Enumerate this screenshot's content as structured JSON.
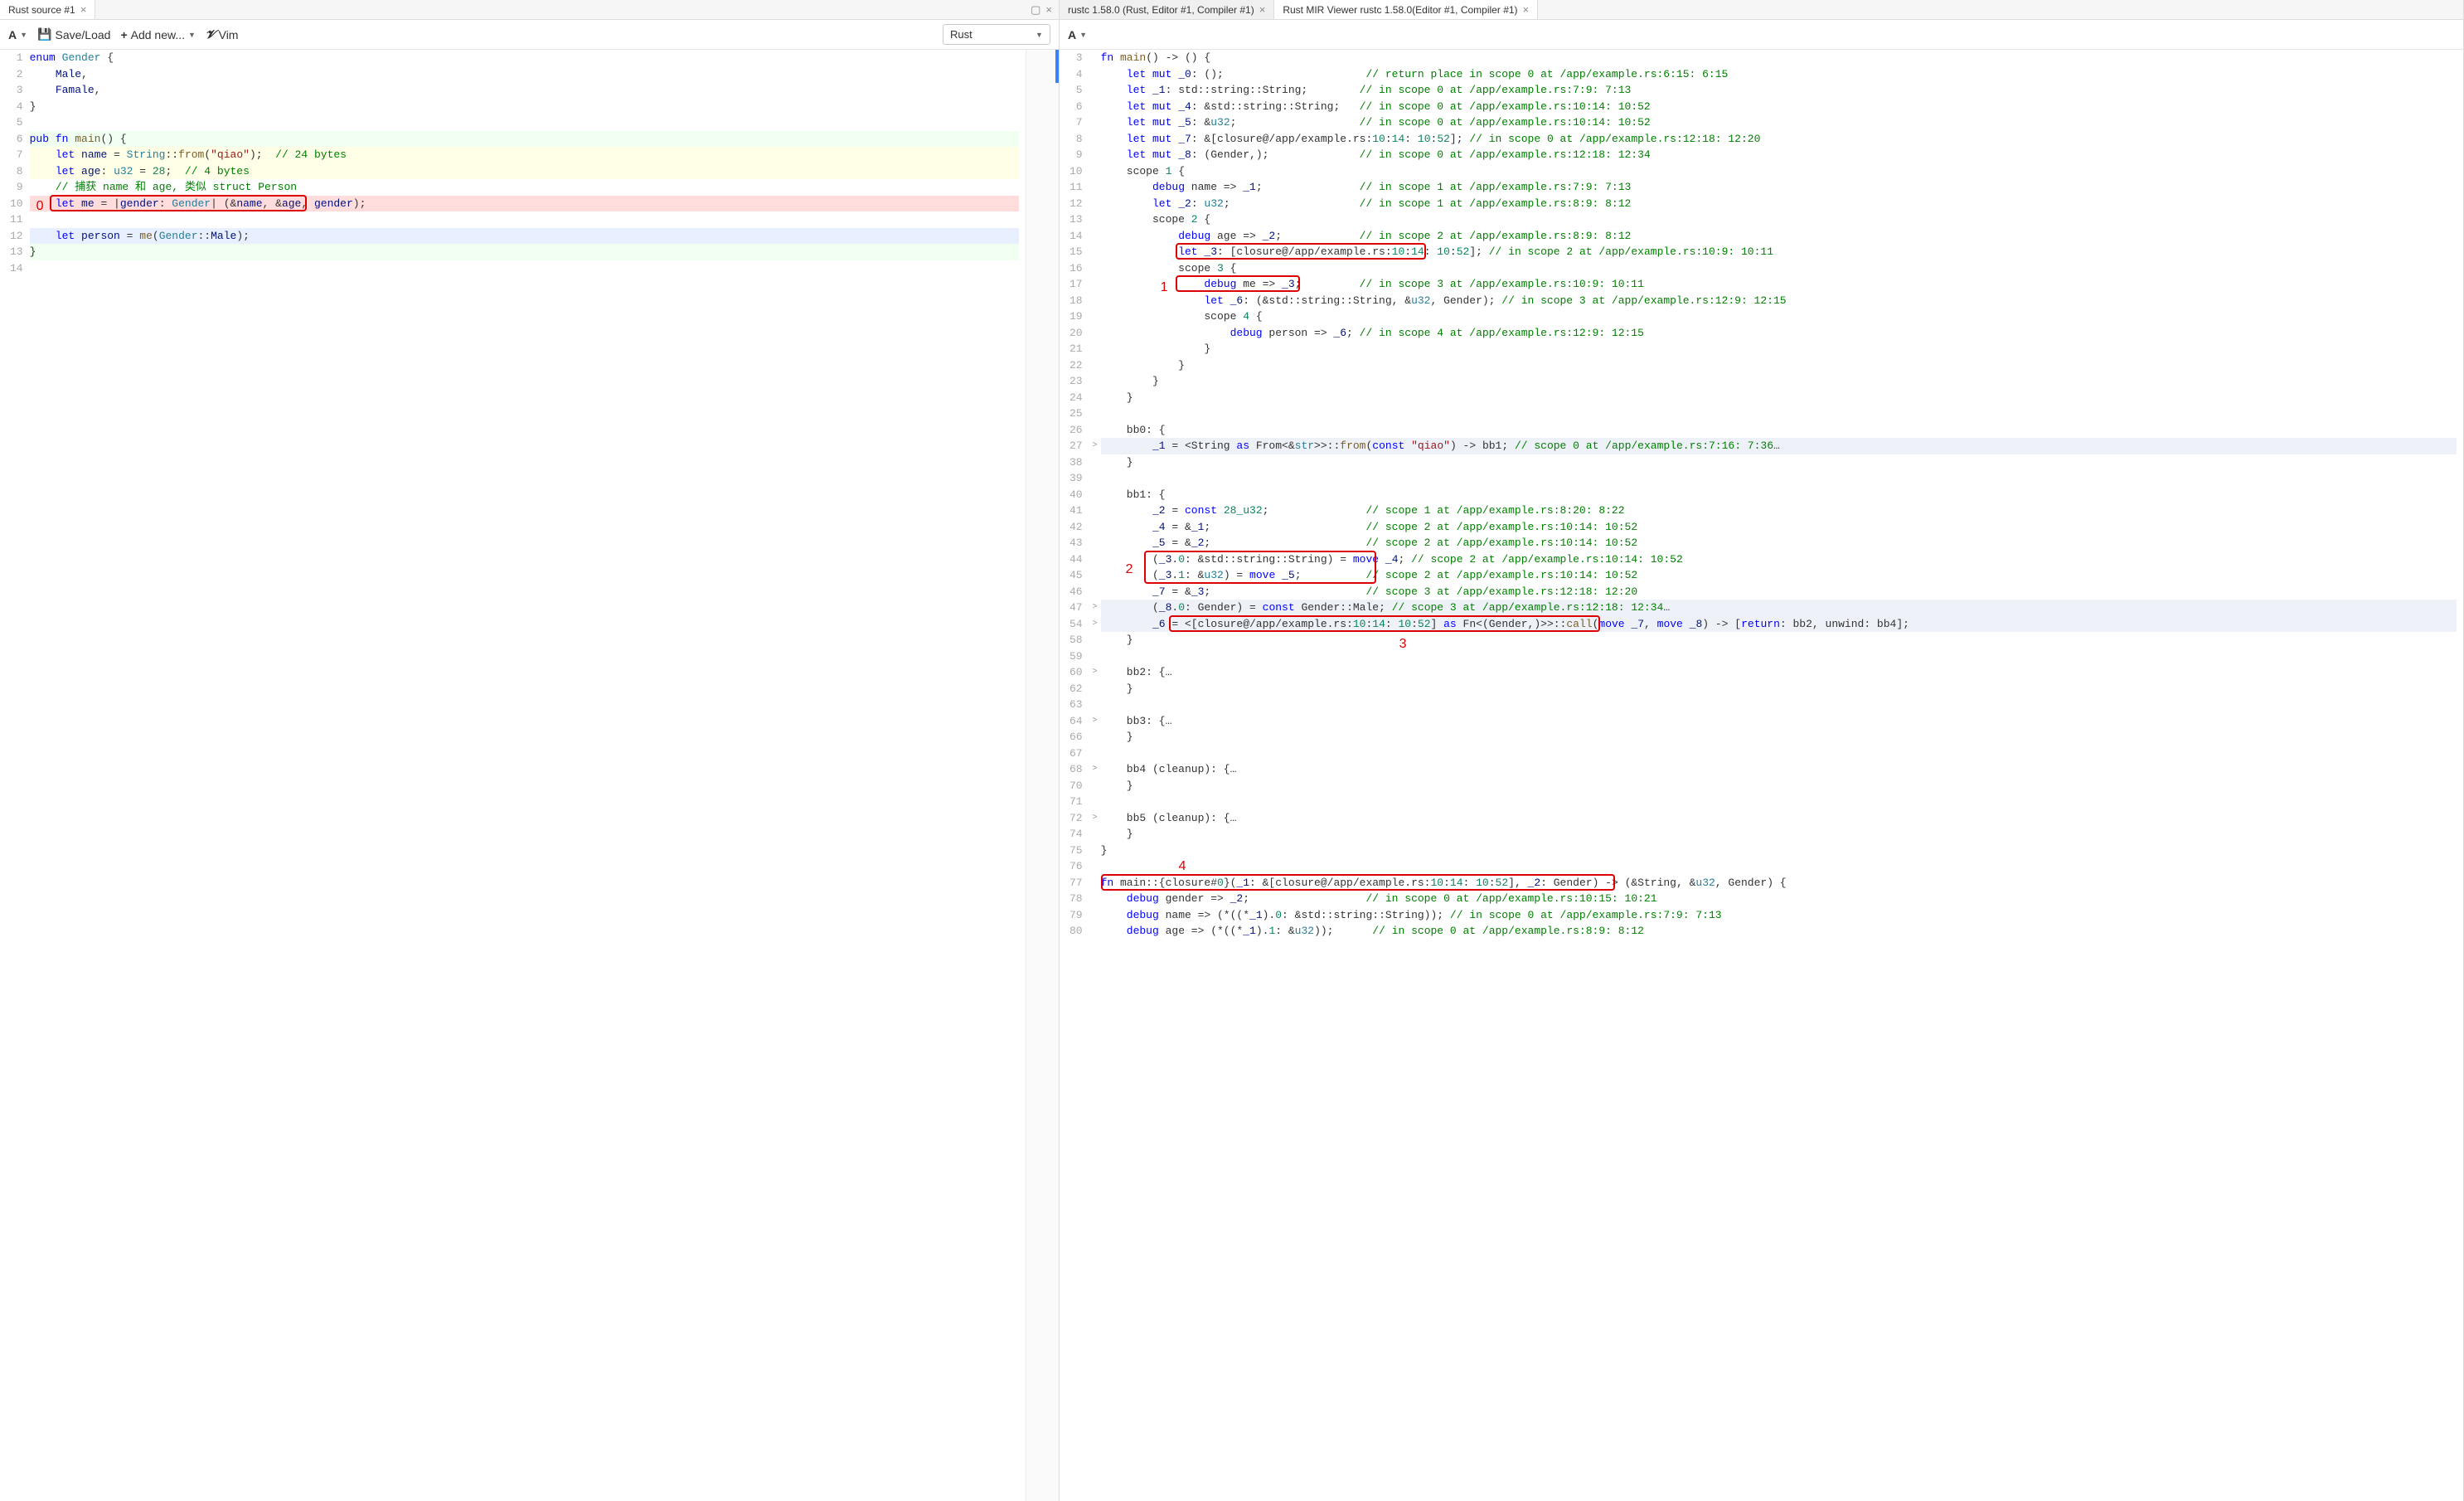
{
  "left": {
    "tab": {
      "label": "Rust source #1"
    },
    "toolbar": {
      "fontBtn": "A",
      "saveLoad": "Save/Load",
      "addNew": "Add new...",
      "vim": "Vim",
      "langSelected": "Rust"
    },
    "lines": [
      {
        "n": 1,
        "html": "<span class='kw'>enum</span> <span class='ty'>Gender</span> {"
      },
      {
        "n": 2,
        "html": "    <span class='id'>Male</span>,"
      },
      {
        "n": 3,
        "html": "    <span class='id'>Famale</span>,"
      },
      {
        "n": 4,
        "html": "}"
      },
      {
        "n": 5,
        "html": ""
      },
      {
        "n": 6,
        "html": "<span class='kw'>pub fn</span> <span class='fn'>main</span>() {",
        "bg": "bg-fn"
      },
      {
        "n": 7,
        "html": "    <span class='kw'>let</span> <span class='id'>name</span> = <span class='ty'>String</span>::<span class='fn'>from</span>(<span class='str'>\"qiao\"</span>);  <span class='cmt'>// 24 bytes</span>",
        "bg": "bg-let"
      },
      {
        "n": 8,
        "html": "    <span class='kw'>let</span> <span class='id'>age</span>: <span class='ty'>u32</span> = <span class='num'>28</span>;  <span class='cmt'>// 4 bytes</span>",
        "bg": "bg-let"
      },
      {
        "n": 9,
        "html": "    <span class='cmt'>// 捕获 name 和 age, 类似 struct Person</span>"
      },
      {
        "n": 10,
        "html": "    <span class='kw'>let</span> <span class='id'>me</span> = |<span class='id'>gender</span>: <span class='ty'>Gender</span>| (&amp;<span class='id'>name</span>, &amp;<span class='id'>age</span>, <span class='id'>gender</span>);",
        "bg": "bg-red",
        "box": true
      },
      {
        "n": 11,
        "html": ""
      },
      {
        "n": 12,
        "html": "    <span class='kw'>let</span> <span class='id'>person</span> = <span class='fn'>me</span>(<span class='ty'>Gender</span>::<span class='id'>Male</span>);",
        "bg": "bg-blue"
      },
      {
        "n": 13,
        "html": "}",
        "bg": "bg-fn"
      },
      {
        "n": 14,
        "html": ""
      }
    ],
    "redLabel0": "0"
  },
  "right": {
    "tabs": [
      {
        "label": "rustc 1.58.0 (Rust, Editor #1, Compiler #1)",
        "active": false
      },
      {
        "label": "Rust MIR Viewer rustc 1.58.0(Editor #1, Compiler #1)",
        "active": true
      }
    ],
    "toolbar": {
      "fontBtn": "A"
    },
    "lines": [
      {
        "n": 3,
        "html": "<span class='kw'>fn</span> <span class='fn'>main</span>() -&gt; () {"
      },
      {
        "n": 4,
        "html": "    <span class='kw'>let mut</span> <span class='id'>_0</span>: ();                      <span class='cmt'>// return place in scope 0 at /app/example.rs:6:15: 6:15</span>"
      },
      {
        "n": 5,
        "html": "    <span class='kw'>let</span> <span class='id'>_1</span>: std::string::String;        <span class='cmt'>// in scope 0 at /app/example.rs:7:9: 7:13</span>"
      },
      {
        "n": 6,
        "html": "    <span class='kw'>let mut</span> <span class='id'>_4</span>: &amp;std::string::String;   <span class='cmt'>// in scope 0 at /app/example.rs:10:14: 10:52</span>"
      },
      {
        "n": 7,
        "html": "    <span class='kw'>let mut</span> <span class='id'>_5</span>: &amp;<span class='ty'>u32</span>;                   <span class='cmt'>// in scope 0 at /app/example.rs:10:14: 10:52</span>"
      },
      {
        "n": 8,
        "html": "    <span class='kw'>let mut</span> <span class='id'>_7</span>: &amp;[closure@/app/example.rs:<span class='num'>10</span>:<span class='num'>14</span>: <span class='num'>10</span>:<span class='num'>52</span>]; <span class='cmt'>// in scope 0 at /app/example.rs:12:18: 12:20</span>"
      },
      {
        "n": 9,
        "html": "    <span class='kw'>let mut</span> <span class='id'>_8</span>: (Gender,);              <span class='cmt'>// in scope 0 at /app/example.rs:12:18: 12:34</span>"
      },
      {
        "n": 10,
        "html": "    scope <span class='num'>1</span> {"
      },
      {
        "n": 11,
        "html": "        <span class='kw'>debug</span> name =&gt; <span class='id'>_1</span>;               <span class='cmt'>// in scope 1 at /app/example.rs:7:9: 7:13</span>"
      },
      {
        "n": 12,
        "html": "        <span class='kw'>let</span> <span class='id'>_2</span>: <span class='ty'>u32</span>;                    <span class='cmt'>// in scope 1 at /app/example.rs:8:9: 8:12</span>"
      },
      {
        "n": 13,
        "html": "        scope <span class='num'>2</span> {"
      },
      {
        "n": 14,
        "html": "            <span class='kw'>debug</span> age =&gt; <span class='id'>_2</span>;            <span class='cmt'>// in scope 2 at /app/example.rs:8:9: 8:12</span>"
      },
      {
        "n": 15,
        "html": "            <span class='kw'>let</span> <span class='id'>_3</span>: [closure@/app/example.rs:<span class='num'>10</span>:<span class='num'>14</span>: <span class='num'>10</span>:<span class='num'>52</span>]; <span class='cmt'>// in scope 2 at /app/example.rs:10:9: 10:11</span>",
        "box": 1
      },
      {
        "n": 16,
        "html": "            scope <span class='num'>3</span> {"
      },
      {
        "n": 17,
        "html": "                <span class='kw'>debug</span> me =&gt; <span class='id'>_3</span>;         <span class='cmt'>// in scope 3 at /app/example.rs:10:9: 10:11</span>",
        "box": "1b"
      },
      {
        "n": 18,
        "html": "                <span class='kw'>let</span> <span class='id'>_6</span>: (&amp;std::string::String, &amp;<span class='ty'>u32</span>, Gender); <span class='cmt'>// in scope 3 at /app/example.rs:12:9: 12:15</span>"
      },
      {
        "n": 19,
        "html": "                scope <span class='num'>4</span> {"
      },
      {
        "n": 20,
        "html": "                    <span class='kw'>debug</span> person =&gt; <span class='id'>_6</span>; <span class='cmt'>// in scope 4 at /app/example.rs:12:9: 12:15</span>"
      },
      {
        "n": 21,
        "html": "                }"
      },
      {
        "n": 22,
        "html": "            }"
      },
      {
        "n": 23,
        "html": "        }"
      },
      {
        "n": 24,
        "html": "    }"
      },
      {
        "n": 25,
        "html": ""
      },
      {
        "n": 26,
        "html": "    bb0: {"
      },
      {
        "n": 27,
        "html": "        <span class='id'>_1</span> = &lt;String <span class='kw'>as</span> From&lt;&amp;<span class='ty'>str</span>&gt;&gt;::<span class='fn'>from</span>(<span class='kw'>const</span> <span class='str'>\"qiao\"</span>) -&gt; bb1; <span class='cmt'>// scope 0 at /app/example.rs:7:16: 7:36</span>…",
        "bg": "bg-hover",
        "fold": ">"
      },
      {
        "n": 38,
        "html": "    }"
      },
      {
        "n": 39,
        "html": ""
      },
      {
        "n": 40,
        "html": "    bb1: {"
      },
      {
        "n": 41,
        "html": "        <span class='id'>_2</span> = <span class='kw'>const</span> <span class='num'>28_u32</span>;               <span class='cmt'>// scope 1 at /app/example.rs:8:20: 8:22</span>"
      },
      {
        "n": 42,
        "html": "        <span class='id'>_4</span> = &amp;<span class='id'>_1</span>;                        <span class='cmt'>// scope 2 at /app/example.rs:10:14: 10:52</span>"
      },
      {
        "n": 43,
        "html": "        <span class='id'>_5</span> = &amp;<span class='id'>_2</span>;                        <span class='cmt'>// scope 2 at /app/example.rs:10:14: 10:52</span>"
      },
      {
        "n": 44,
        "html": "        (<span class='id'>_3</span>.<span class='num'>0</span>: &amp;std::string::String) = <span class='kw'>move</span> <span class='id'>_4</span>; <span class='cmt'>// scope 2 at /app/example.rs:10:14: 10:52</span>",
        "box": 2
      },
      {
        "n": 45,
        "html": "        (<span class='id'>_3</span>.<span class='num'>1</span>: &amp;<span class='ty'>u32</span>) = <span class='kw'>move</span> <span class='id'>_5</span>;          <span class='cmt'>// scope 2 at /app/example.rs:10:14: 10:52</span>"
      },
      {
        "n": 46,
        "html": "        <span class='id'>_7</span> = &amp;<span class='id'>_3</span>;                        <span class='cmt'>// scope 3 at /app/example.rs:12:18: 12:20</span>"
      },
      {
        "n": 47,
        "html": "        (<span class='id'>_8</span>.<span class='num'>0</span>: Gender) = <span class='kw'>const</span> Gender::Male; <span class='cmt'>// scope 3 at /app/example.rs:12:18: 12:34</span>…",
        "bg": "bg-hover",
        "fold": ">"
      },
      {
        "n": 54,
        "html": "        <span class='id'>_6</span> = &lt;[closure@/app/example.rs:<span class='num'>10</span>:<span class='num'>14</span>: <span class='num'>10</span>:<span class='num'>52</span>] <span class='kw'>as</span> Fn&lt;(Gender,)&gt;&gt;::<span class='fn'>call</span>(<span class='kw'>move</span> <span class='id'>_7</span>, <span class='kw'>move</span> <span class='id'>_8</span>) -&gt; [<span class='kw'>return</span>: bb2, unwind: bb4];",
        "bg": "bg-hover",
        "fold": ">",
        "box": 3
      },
      {
        "n": 58,
        "html": "    }"
      },
      {
        "n": 59,
        "html": ""
      },
      {
        "n": 60,
        "html": "    bb2: {…",
        "fold": ">"
      },
      {
        "n": 62,
        "html": "    }"
      },
      {
        "n": 63,
        "html": ""
      },
      {
        "n": 64,
        "html": "    bb3: {…",
        "fold": ">"
      },
      {
        "n": 66,
        "html": "    }"
      },
      {
        "n": 67,
        "html": ""
      },
      {
        "n": 68,
        "html": "    bb4 (cleanup): {…",
        "fold": ">"
      },
      {
        "n": 70,
        "html": "    }"
      },
      {
        "n": 71,
        "html": ""
      },
      {
        "n": 72,
        "html": "    bb5 (cleanup): {…",
        "fold": ">"
      },
      {
        "n": 74,
        "html": "    }"
      },
      {
        "n": 75,
        "html": "}"
      },
      {
        "n": 76,
        "html": ""
      },
      {
        "n": 77,
        "html": "<span class='kw'>fn</span> main::{closure#<span class='num'>0</span>}(<span class='id'>_1</span>: &amp;[closure@/app/example.rs:<span class='num'>10</span>:<span class='num'>14</span>: <span class='num'>10</span>:<span class='num'>52</span>], <span class='id'>_2</span>: Gender) -&gt; (&amp;String, &amp;<span class='ty'>u32</span>, Gender) {",
        "box": 4
      },
      {
        "n": 78,
        "html": "    <span class='kw'>debug</span> gender =&gt; <span class='id'>_2</span>;                  <span class='cmt'>// in scope 0 at /app/example.rs:10:15: 10:21</span>"
      },
      {
        "n": 79,
        "html": "    <span class='kw'>debug</span> name =&gt; (*((*<span class='id'>_1</span>).<span class='num'>0</span>: &amp;std::string::String)); <span class='cmt'>// in scope 0 at /app/example.rs:7:9: 7:13</span>"
      },
      {
        "n": 80,
        "html": "    <span class='kw'>debug</span> age =&gt; (*((*<span class='id'>_1</span>).<span class='num'>1</span>: &amp;<span class='ty'>u32</span>));      <span class='cmt'>// in scope 0 at /app/example.rs:8:9: 8:12</span>"
      }
    ],
    "redLabels": {
      "1": "1",
      "2": "2",
      "3": "3",
      "4": "4"
    }
  }
}
